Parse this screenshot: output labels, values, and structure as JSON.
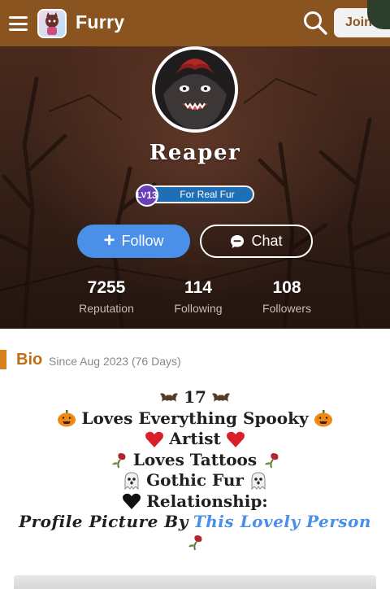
{
  "app": {
    "title": "Furry",
    "join_label": "Join"
  },
  "profile": {
    "username": "Reaper",
    "level_prefix": "LV",
    "level": "13",
    "level_title": "For Real Fur",
    "follow_label": "Follow",
    "chat_label": "Chat"
  },
  "stats": [
    {
      "value": "7255",
      "label": "Reputation"
    },
    {
      "value": "114",
      "label": "Following"
    },
    {
      "value": "108",
      "label": "Followers"
    }
  ],
  "bio": {
    "title": "Bio",
    "since": "Since Aug 2023 (76 Days)",
    "lines": {
      "line1": "17",
      "line2": "Loves Everything Spooky",
      "line3": "Artist",
      "line4": "Loves Tattoos",
      "line5": "Gothic Fur",
      "line6": "Relationship:",
      "line7_prefix": "Profile Picture By",
      "line7_link": "This Lovely Person"
    }
  },
  "colors": {
    "topbar": "#8a5421",
    "accent": "#d9801e",
    "follow_button": "#4a8fe8",
    "link": "#4a8fe8",
    "level_badge": "#6a3fb9"
  },
  "icons": [
    "menu-icon",
    "app-icon",
    "search-icon",
    "plus-icon",
    "chat-bubble-icon",
    "bat-emoji",
    "pumpkin-emoji",
    "heart-emoji",
    "wilted-rose-emoji",
    "ghost-emoji",
    "black-heart-emoji"
  ]
}
